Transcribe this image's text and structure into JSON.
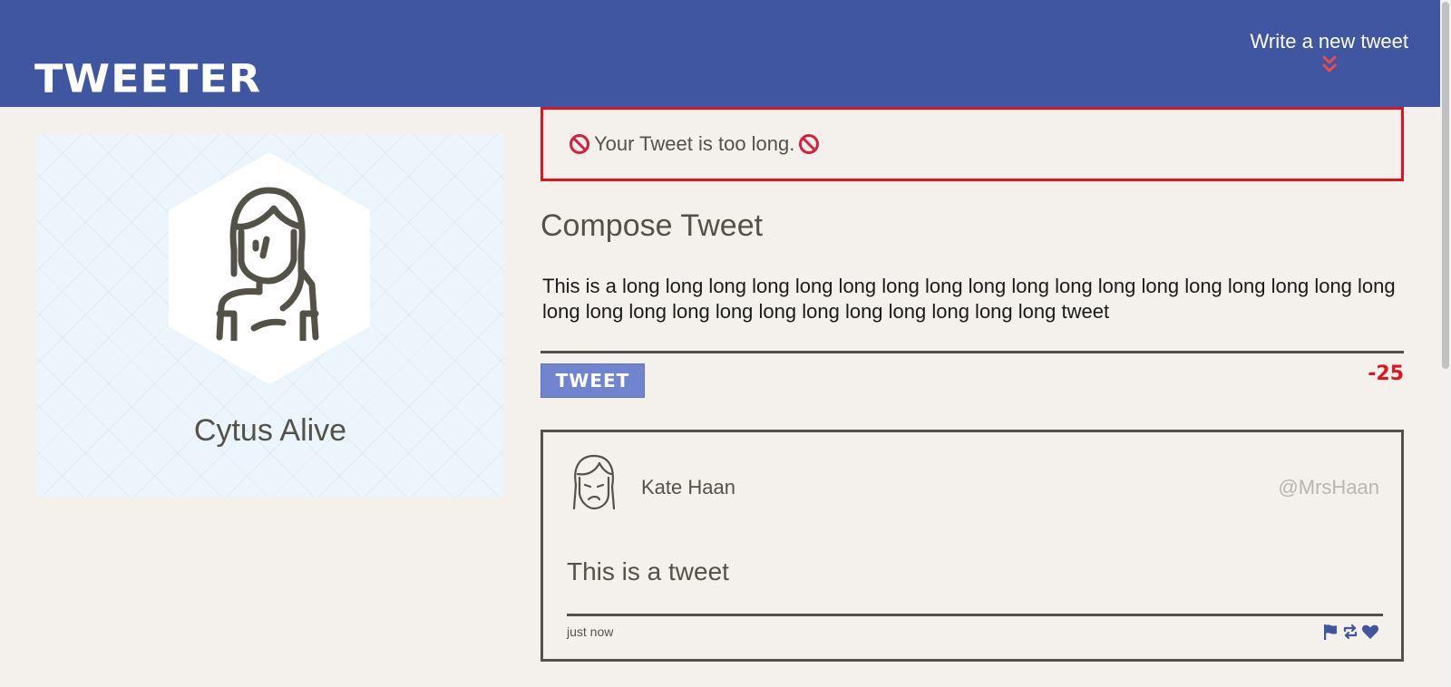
{
  "nav": {
    "brand": "TWEETER",
    "compose_toggle_label": "Write a new tweet",
    "chevron_icon": "double-chevron-down-icon",
    "chevron_color": "#e8504a"
  },
  "profile": {
    "name": "Cytus Alive",
    "avatar_icon": "woman-avatar-icon"
  },
  "error": {
    "icon": "ban-icon",
    "message": "Your Tweet is too long.",
    "border_color": "#e0141e"
  },
  "compose": {
    "title": "Compose Tweet",
    "textarea_value": "This is a long long long long long long long long long long long long long long long long long long long long long long long long long long long long long long tweet",
    "tweet_button_label": "TWEET",
    "counter": "-25"
  },
  "tweets": [
    {
      "author_name": "Kate Haan",
      "handle": "@MrsHaan",
      "content": "This is a tweet",
      "timestamp": "just now",
      "avatar_icon": "woman-avatar-icon",
      "actions": [
        "flag-icon",
        "retweet-icon",
        "heart-icon"
      ]
    }
  ],
  "colors": {
    "nav_bg": "#4056a1",
    "page_bg": "#f4f1ec",
    "accent_button": "#7084d0",
    "text": "#545149",
    "error": "#e0141e"
  }
}
